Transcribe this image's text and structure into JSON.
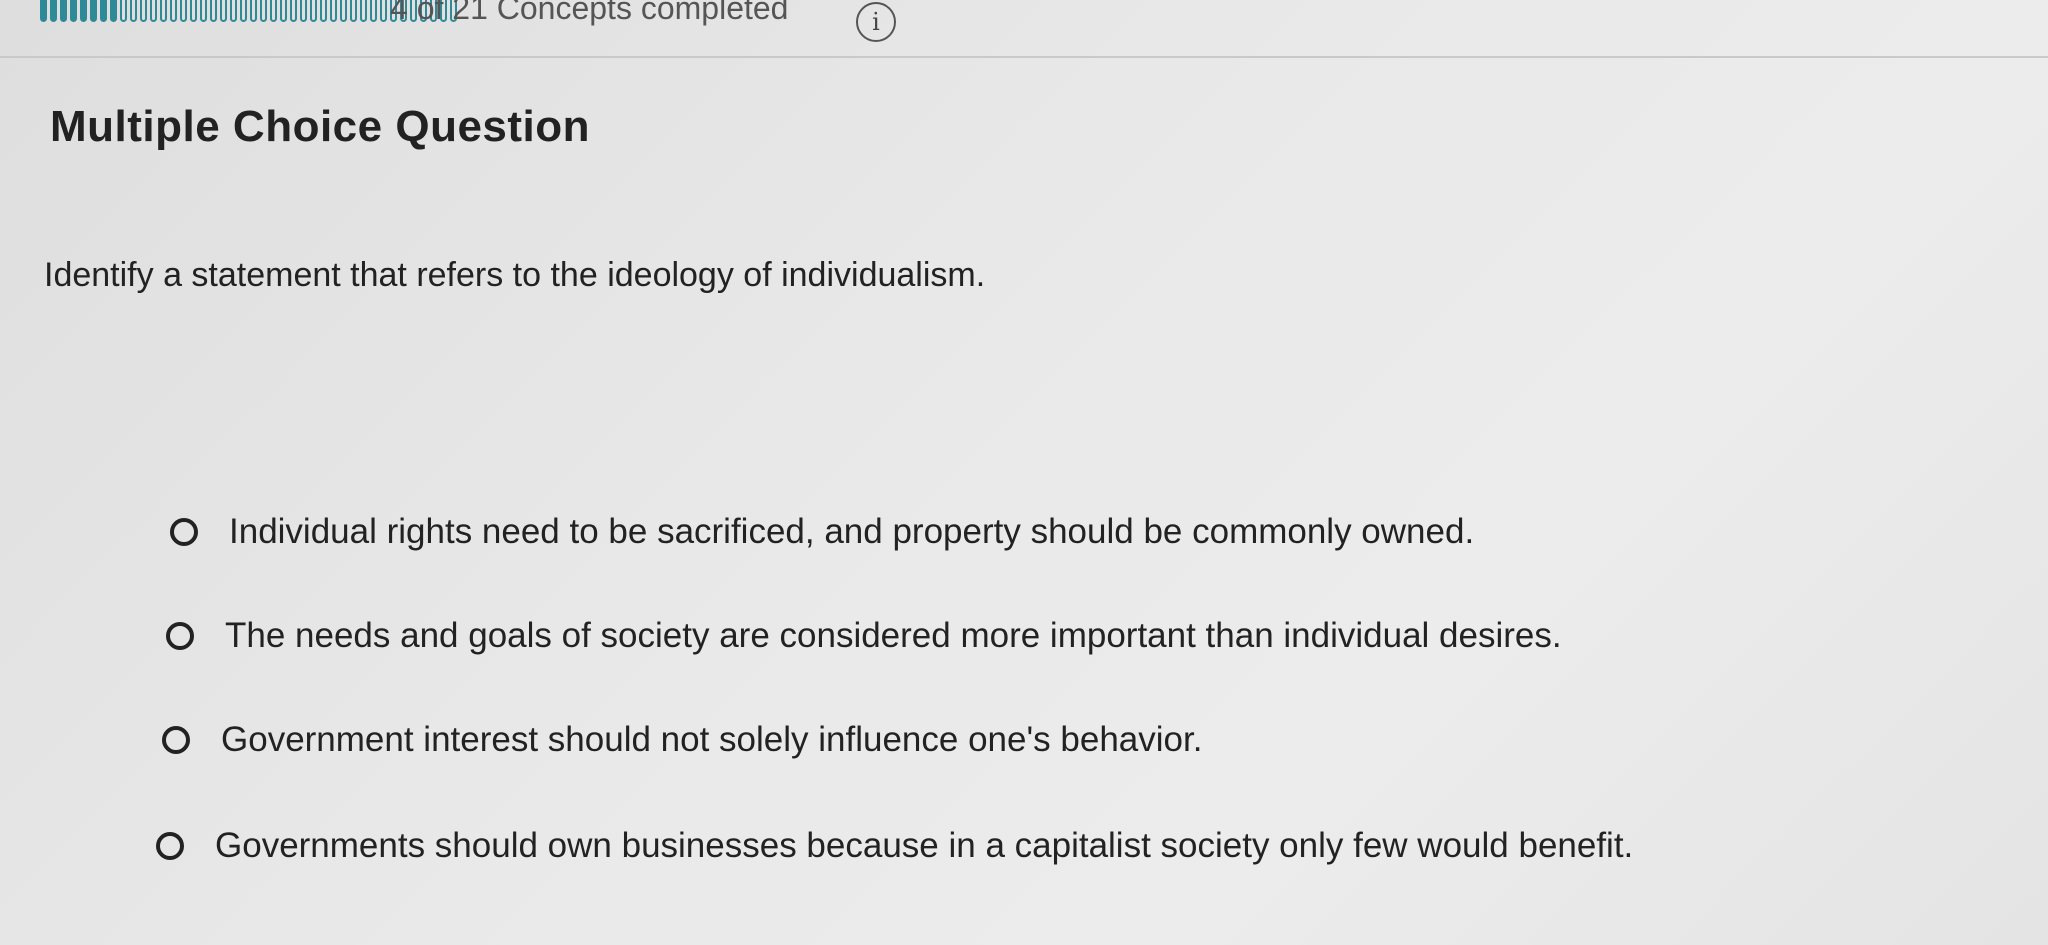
{
  "header": {
    "progress": {
      "completed": 4,
      "total": 21,
      "label": "4 of 21 Concepts completed"
    },
    "info_icon_glyph": "i",
    "accent_color": "#2f8a98"
  },
  "question": {
    "type_title": "Multiple Choice Question",
    "prompt": "Identify a statement that refers to the ideology of individualism.",
    "options": [
      {
        "label": "Individual rights need to be sacrificed, and property should be commonly owned.",
        "selected": false
      },
      {
        "label": "The needs and goals of society are considered more important than individual desires.",
        "selected": false
      },
      {
        "label": "Government interest should not solely influence one's behavior.",
        "selected": false
      },
      {
        "label": "Governments should own businesses because in a capitalist society only few would benefit.",
        "selected": false
      }
    ]
  }
}
